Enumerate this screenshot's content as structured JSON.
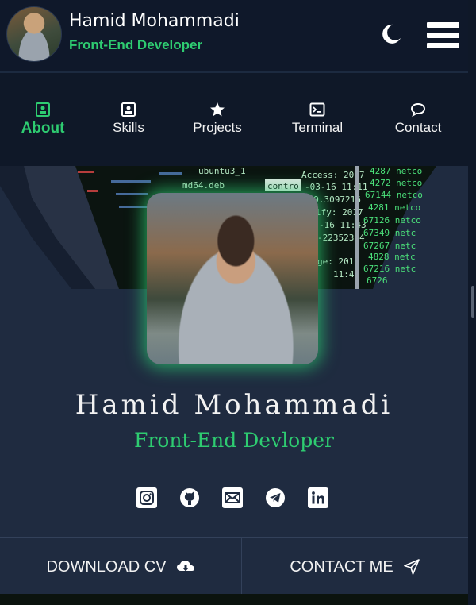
{
  "header": {
    "name": "Hamid Mohammadi",
    "role": "Front-End Developer"
  },
  "nav": {
    "items": [
      {
        "label": "About",
        "icon": "id-card-icon",
        "active": true
      },
      {
        "label": "Skills",
        "icon": "list-card-icon",
        "active": false
      },
      {
        "label": "Projects",
        "icon": "star-icon",
        "active": false
      },
      {
        "label": "Terminal",
        "icon": "terminal-icon",
        "active": false
      },
      {
        "label": "Contact",
        "icon": "chat-bubble-icon",
        "active": false
      }
    ]
  },
  "profile": {
    "name": "Hamid Mohammadi",
    "role": "Front-End Devloper"
  },
  "socials": [
    "instagram-icon",
    "github-icon",
    "email-icon",
    "telegram-icon",
    "linkedin-icon"
  ],
  "actions": {
    "download_cv": "DOWNLOAD CV",
    "contact_me": "CONTACT ME"
  },
  "banner_text": {
    "a": "Access: 2017",
    "b": "-03-16 11:11",
    "c": "-19.3097216",
    "d": "lfy: 2017",
    "e": "-16 11:43",
    "f": "-22352354",
    "g": "ge: 2017",
    "h": "11:43",
    "i": "ubuntu3_1",
    "j": "md64.deb",
    "k": "control",
    "l": "4287 netco",
    "m": "4272 netco",
    "n": "67144 netco",
    "o": "4281 netco",
    "p": "67126 netco",
    "q": "67349 netc",
    "r": "67267 netc",
    "s": "4828 netc",
    "t": "67216 netc",
    "u": "6726"
  },
  "colors": {
    "accent": "#2ecc71",
    "background": "#0f1828",
    "card": "#1f2b40"
  }
}
